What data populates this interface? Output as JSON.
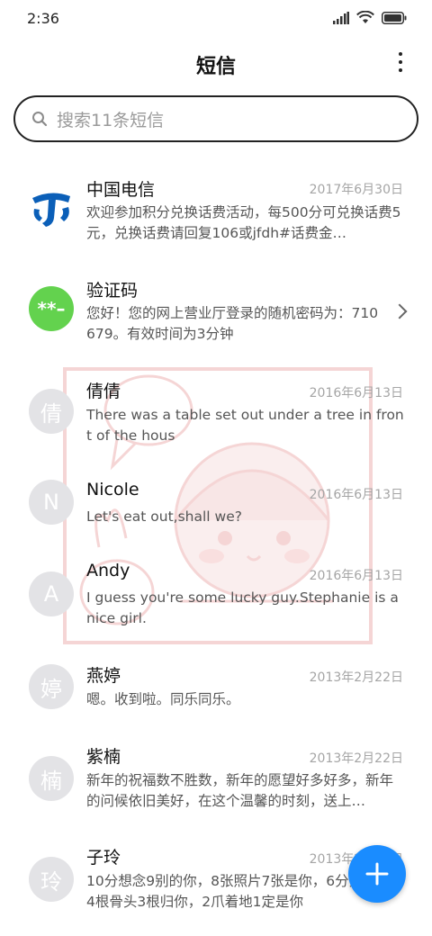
{
  "status_bar": {
    "time": "2:36"
  },
  "header": {
    "title": "短信"
  },
  "search": {
    "placeholder": "搜索11条短信"
  },
  "conversations": [
    {
      "avatar_text": "",
      "avatar_icon": "china-telecom-logo-icon",
      "name": "中国电信",
      "date": "2017年6月30日",
      "preview": "欢迎参加积分兑换话费活动，每500分可兑换话费5元，兑换话费请回复106或jfdh#话费金…"
    },
    {
      "avatar_text": "**–",
      "name": "验证码",
      "date": "",
      "preview": "您好！您的网上营业厅登录的随机密码为：710679。有效时间为3分钟",
      "avatar_color": "#63d24e"
    },
    {
      "avatar_text": "倩",
      "name": "倩倩",
      "date": "2016年6月13日",
      "preview": "There was a table set out under a tree in front of the hous"
    },
    {
      "avatar_text": "N",
      "name": "Nicole",
      "date": "2016年6月13日",
      "preview": "Let's eat out,shall we?"
    },
    {
      "avatar_text": "A",
      "name": "Andy",
      "date": "2016年6月13日",
      "preview": "I guess you're some lucky guy.Stephanie is a nice girl."
    },
    {
      "avatar_text": "婷",
      "name": "燕婷",
      "date": "2013年2月22日",
      "preview": "嗯。收到啦。同乐同乐。"
    },
    {
      "avatar_text": "楠",
      "name": "紫楠",
      "date": "2013年2月22日",
      "preview": "新年的祝福数不胜数，新年的愿望好多好多，新年的问候依旧美好，在这个温馨的时刻，送上…"
    },
    {
      "avatar_text": "玲",
      "name": "子玲",
      "date": "2013年2月22日",
      "preview": "10分想念9别的你，8张照片7张是你，6分只像你，4根骨头3根归你，2爪着地1定是你"
    }
  ],
  "colors": {
    "accent": "#1a8cff",
    "avatar_gray": "#e3e3e6",
    "telecom_blue": "#0b5fb8"
  }
}
